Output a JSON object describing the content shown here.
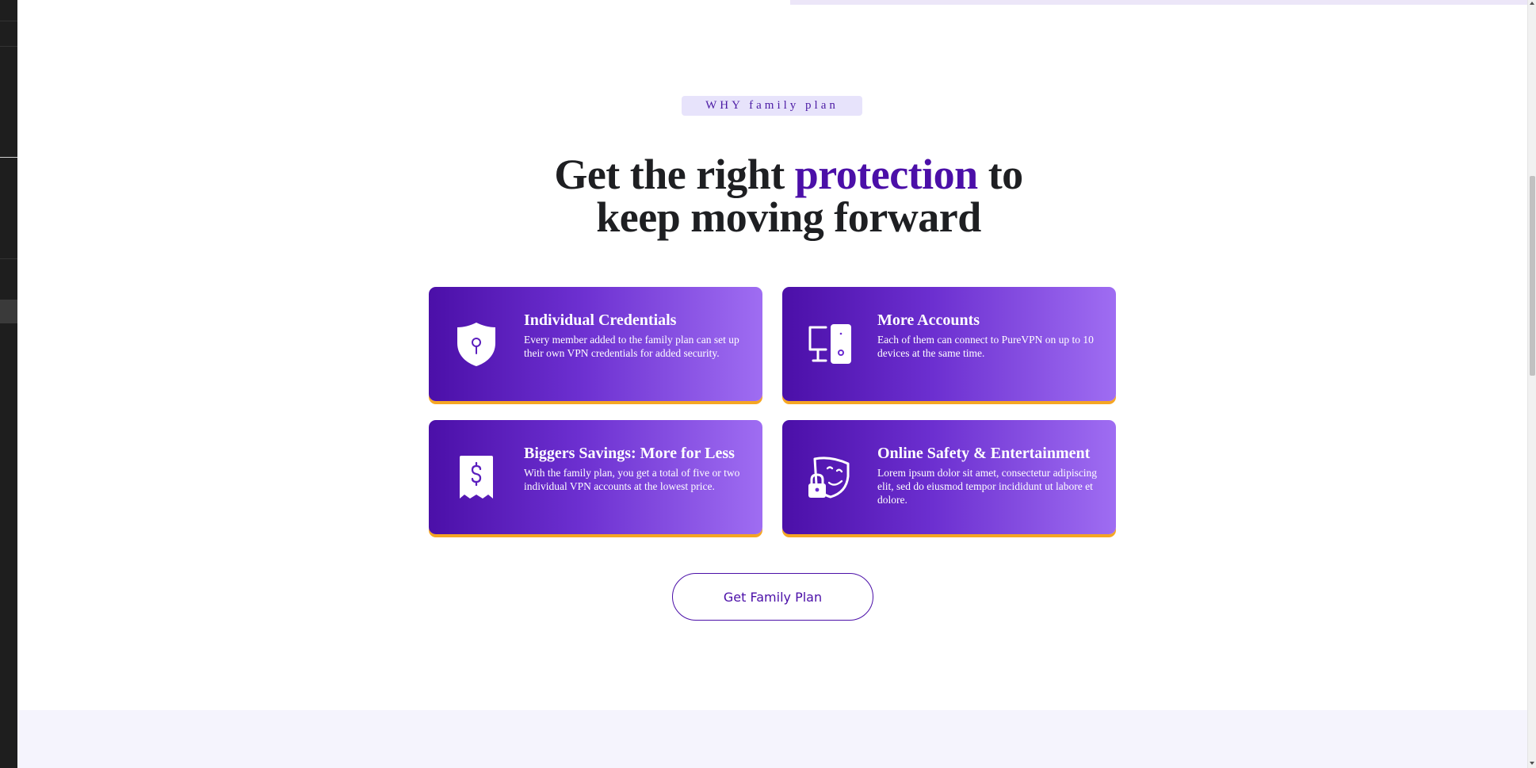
{
  "section": {
    "eyebrow": "WHY family plan",
    "headline": {
      "part1": "Get the right ",
      "accent": "protection",
      "part2": " to",
      "line2": "keep moving forward"
    }
  },
  "features": [
    {
      "icon": "shield-keyhole-icon",
      "title": "Individual Credentials",
      "description": "Every member added to the family plan can set up their own VPN credentials for added security."
    },
    {
      "icon": "devices-icon",
      "title": "More Accounts",
      "description": "Each of them can connect to PureVPN on up to 10 devices at the same time."
    },
    {
      "icon": "dollar-receipt-icon",
      "title": "Biggers Savings: More for Less",
      "description": "With the family plan, you get a total of five or two individual VPN accounts at the lowest price."
    },
    {
      "icon": "theater-masks-lock-icon",
      "title": "Online Safety & Entertainment",
      "description": "Lorem ipsum dolor sit amet, consectetur adipiscing elit, sed do eiusmod tempor incididunt ut labore et dolore."
    }
  ],
  "cta": {
    "label": "Get Family Plan"
  },
  "colors": {
    "brand": "#4b0fa8",
    "card_gradient_end": "#9f6df2",
    "card_underline": "#f5a623",
    "eyebrow_bg": "#e7e3fb",
    "heading_text": "#1e1f22"
  }
}
